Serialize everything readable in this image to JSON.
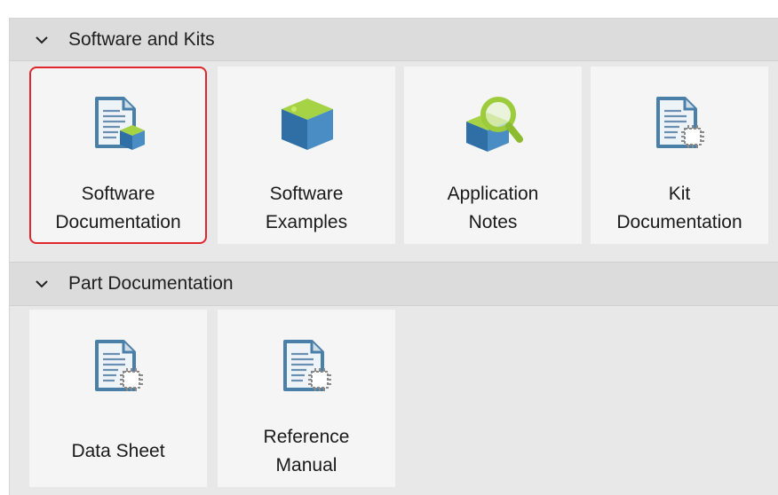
{
  "sections": [
    {
      "title": "Software and Kits",
      "tiles": [
        {
          "label": "Software\nDocumentation",
          "icon": "document-cube-icon",
          "selected": true
        },
        {
          "label": "Software\nExamples",
          "icon": "cube-icon",
          "selected": false
        },
        {
          "label": "Application\nNotes",
          "icon": "magnifier-cube-icon",
          "selected": false
        },
        {
          "label": "Kit\nDocumentation",
          "icon": "document-chip-icon",
          "selected": false
        }
      ]
    },
    {
      "title": "Part Documentation",
      "tiles": [
        {
          "label": "Data Sheet",
          "icon": "document-chip-icon",
          "selected": false
        },
        {
          "label": "Reference\nManual",
          "icon": "document-chip-icon",
          "selected": false
        }
      ]
    }
  ],
  "colors": {
    "selection_border": "#e0272d",
    "cube_blue": "#3d7fb8",
    "cube_green": "#9ccc3c",
    "doc_blue": "#4a7fa8"
  }
}
